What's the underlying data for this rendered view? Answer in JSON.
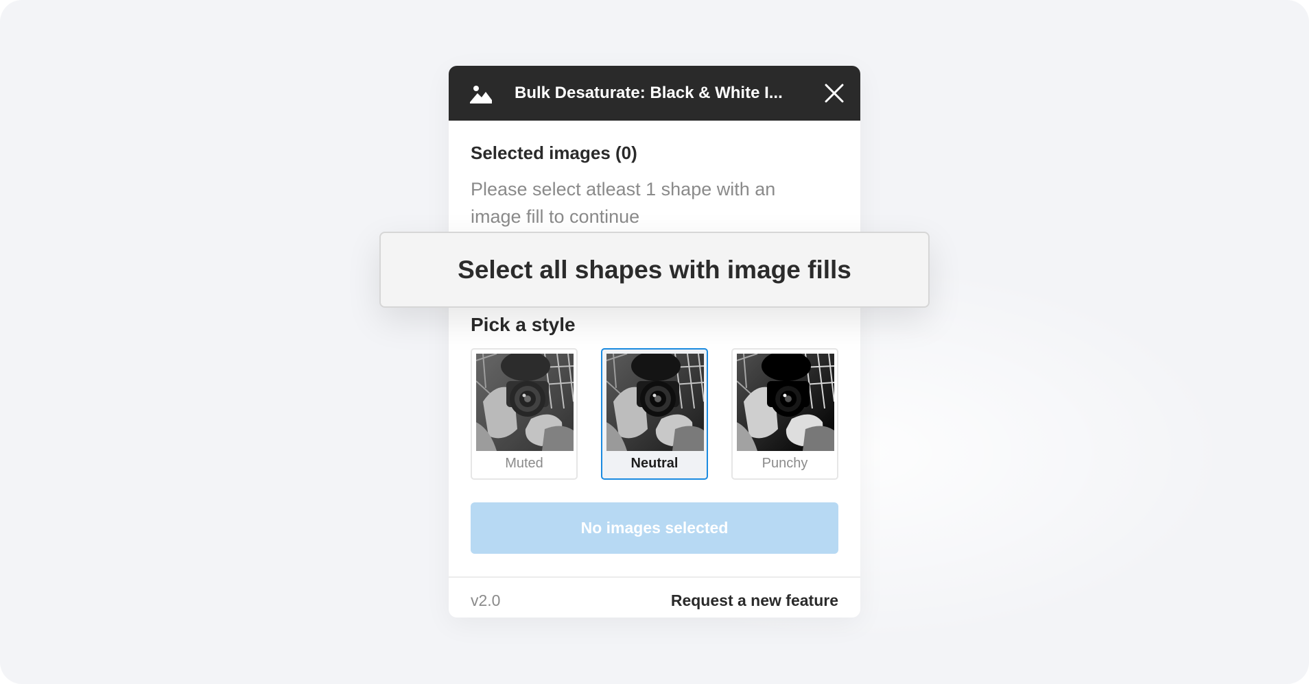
{
  "window": {
    "title": "Bulk Desaturate: Black & White I...",
    "title_icon": "image-icon",
    "close_icon": "close-icon"
  },
  "selection": {
    "heading": "Selected images (0)",
    "help_text": "Please select atleast 1 shape with an image fill to continue"
  },
  "floating_button": {
    "label": "Select all shapes with image fills"
  },
  "styles": {
    "heading": "Pick a style",
    "options": [
      {
        "label": "Muted",
        "selected": false
      },
      {
        "label": "Neutral",
        "selected": true
      },
      {
        "label": "Punchy",
        "selected": false
      }
    ]
  },
  "action_button": {
    "label": "No images selected",
    "enabled": false
  },
  "footer": {
    "version": "v2.0",
    "link_label": "Request a new feature"
  },
  "colors": {
    "background": "#f3f4f7",
    "titlebar": "#2a2a2a",
    "accent": "#1a8ae0",
    "disabled_button": "#b7d9f3"
  }
}
